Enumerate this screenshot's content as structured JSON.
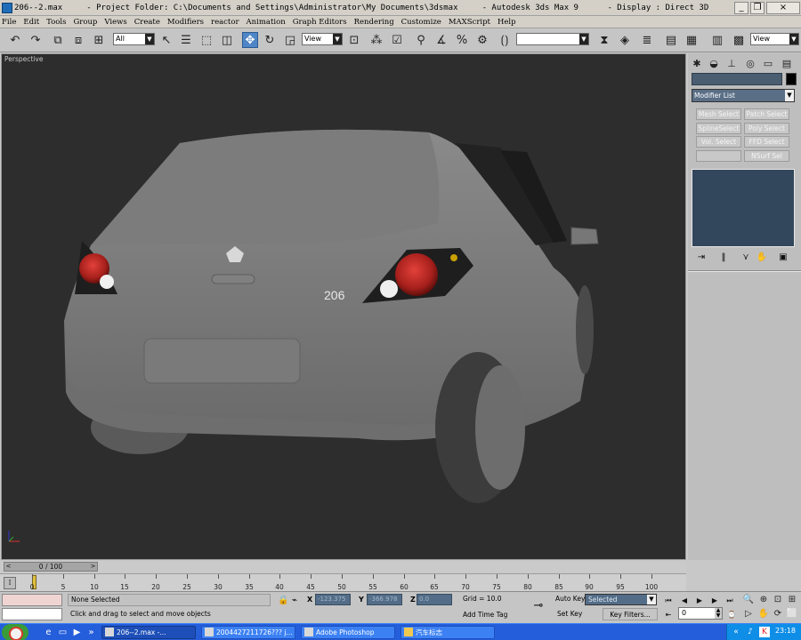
{
  "window": {
    "title": "206--2.max     - Project Folder: C:\\Documents and Settings\\Administrator\\My Documents\\3dsmax     - Autodesk 3ds Max 9      - Display : Direct 3D",
    "minimize": "_",
    "maximize": "❐",
    "close": "×"
  },
  "menu": [
    "File",
    "Edit",
    "Tools",
    "Group",
    "Views",
    "Create",
    "Modifiers",
    "reactor",
    "Animation",
    "Graph Editors",
    "Rendering",
    "Customize",
    "MAXScript",
    "Help"
  ],
  "toolbar": {
    "selection_filter": "All",
    "ref_coord_1": "View",
    "ref_coord_2": "View",
    "named_selection": ""
  },
  "viewport": {
    "label": "Perspective",
    "badge_text": "206"
  },
  "command_panel": {
    "modifier_list": "Modifier List",
    "buttons": [
      "Mesh Select",
      "Patch Select",
      "SplineSelect",
      "Poly Select",
      "Vol. Select",
      "FFD Select",
      "",
      "NSurf Sel"
    ]
  },
  "time_slider": {
    "label": "0 / 100",
    "prev": "<",
    "next": ">"
  },
  "trackbar": {
    "ticks": [
      "0",
      "5",
      "10",
      "15",
      "20",
      "25",
      "30",
      "35",
      "40",
      "45",
      "50",
      "55",
      "60",
      "65",
      "70",
      "75",
      "80",
      "85",
      "90",
      "95",
      "100"
    ]
  },
  "status": {
    "selection": "None Selected",
    "prompt": "Click and drag to select and move objects",
    "x_label": "X",
    "x_value": "-123.375",
    "y_label": "Y",
    "y_value": "-366.978",
    "z_label": "Z",
    "z_value": "0.0",
    "grid": "Grid = 10.0",
    "add_time_tag": "Add Time Tag",
    "auto_key": "Auto Key",
    "set_key": "Set Key",
    "key_mode": "Selected",
    "key_filters": "Key Filters...",
    "frame": "0"
  },
  "taskbar": {
    "tasks": [
      "206--2.max  -...",
      "2004427211726??? j...",
      "Adobe Photoshop",
      "汽车标志"
    ],
    "clock": "23:18"
  }
}
